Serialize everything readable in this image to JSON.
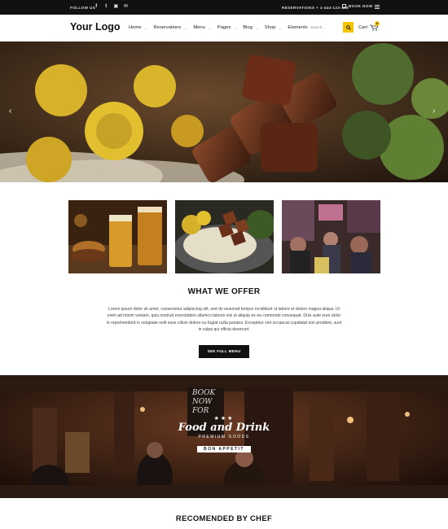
{
  "topbar": {
    "follow_label": "FOLLOW US",
    "social_icons": [
      "facebook-icon",
      "twitter-icon",
      "instagram-icon",
      "email-icon"
    ],
    "reservations": "RESERVATIONS + 1-444-123-456",
    "book_label": "BOOK NOW"
  },
  "header": {
    "logo": "Your Logo",
    "nav": [
      {
        "label": "Home",
        "dropdown": true
      },
      {
        "label": "Reservations",
        "dropdown": true
      },
      {
        "label": "Menu",
        "dropdown": true
      },
      {
        "label": "Pages",
        "dropdown": true
      },
      {
        "label": "Blog",
        "dropdown": true
      },
      {
        "label": "Shop",
        "dropdown": true
      },
      {
        "label": "Elements",
        "dropdown": false
      }
    ],
    "search_placeholder": "Search...",
    "cart_label": "Cart",
    "cart_count": "0"
  },
  "offer": {
    "title": "WHAT WE OFFER",
    "text": "Lorem ipsum dolor sit amet, consectetur adipiscing elit, sed do eiusmod tempor incididunt ut labore et dolore magna aliqua. Ut enim ad minim veniam, quis nostrud exercitation ullamco laboris nisi ut aliquip ex ea commodo consequat. Duis aute irure dolor in reprehenderit in voluptate velit esse cillum dolore eu fugiat nulla pariatur. Excepteur sint occaecat cupidatat non proident, sunt in culpa qui officia deserunt.",
    "button": "SEE FULL MENU"
  },
  "banner": {
    "sign_book": "BOOK",
    "sign_now": "NOW",
    "sign_for": "FOR",
    "emblem_line1": "Food and Drink",
    "emblem_line2": "PREMIUM GOODS",
    "emblem_line3": "BON APPETIT"
  },
  "chef": {
    "title": "RECOMENDED BY CHEF"
  },
  "colors": {
    "accent": "#f2c500",
    "dark": "#111111"
  }
}
